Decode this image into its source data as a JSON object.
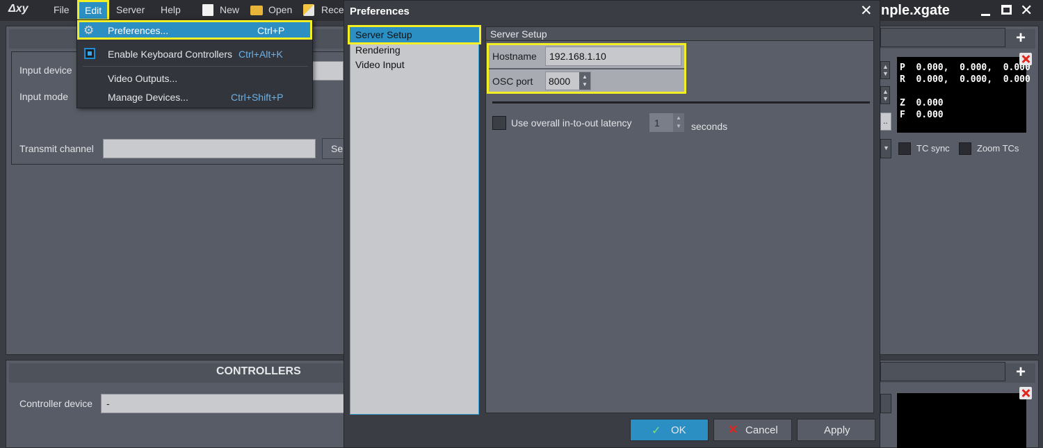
{
  "menubar": {
    "logo": "Δxy",
    "file": "File",
    "edit": "Edit",
    "server": "Server",
    "help": "Help",
    "new": "New",
    "open": "Open",
    "recent": "Rece",
    "preferences_title": "Preferences",
    "window_title": "nple.xgate"
  },
  "edit_menu": {
    "items": [
      {
        "label": "Preferences...",
        "shortcut": "Ctrl+P"
      },
      {
        "label": "Enable Keyboard Controllers",
        "shortcut": "Ctrl+Alt+K"
      },
      {
        "label": "Video Outputs...",
        "shortcut": ""
      },
      {
        "label": "Manage Devices...",
        "shortcut": "Ctrl+Shift+P"
      }
    ]
  },
  "background": {
    "input_device_label": "Input device",
    "input_mode_label": "Input mode",
    "transmit_channel_label": "Transmit channel",
    "transmit_button": "Se",
    "controllers_header": "CONTROLLERS",
    "controller_device_label": "Controller device",
    "controller_device_value": "-",
    "readout": {
      "p_line": "P  0.000,  0.000,  0.000",
      "r_line": "R  0.000,  0.000,  0.000",
      "z_line": "Z  0.000",
      "f_line": "F  0.000"
    },
    "tc_sync": "TC sync",
    "zoom_tcs": "Zoom TCs",
    "ellipsis": "..",
    "plus": "+"
  },
  "preferences": {
    "title": "Preferences",
    "sidebar": [
      "Server Setup",
      "Rendering",
      "Video Input"
    ],
    "section_title": "Server Setup",
    "hostname_label": "Hostname",
    "hostname_value": "192.168.1.10",
    "osc_port_label": "OSC port",
    "osc_port_value": "8000",
    "latency_label": "Use overall in-to-out latency",
    "latency_value": "1",
    "latency_unit": "seconds",
    "ok": "OK",
    "cancel": "Cancel",
    "apply": "Apply"
  },
  "colors": {
    "highlight": "#f4ef25",
    "selection": "#2b8fc4",
    "shortcut": "#6cb2e8",
    "close_red": "#e2261d"
  }
}
